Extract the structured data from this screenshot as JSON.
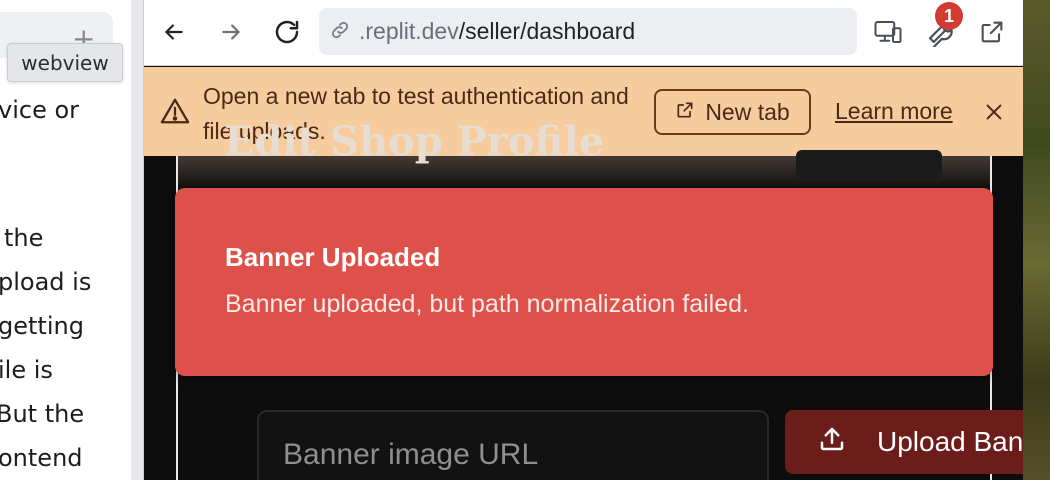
{
  "chat": {
    "tooltip": "webview",
    "lines": [
      "vice or",
      "the",
      "pload is",
      "getting",
      "ile is",
      "But the",
      "ontend"
    ]
  },
  "browser": {
    "url_host": ".replit.dev",
    "url_path": "/seller/dashboard",
    "badge_count": "1",
    "icons": [
      "back-arrow-icon",
      "forward-arrow-icon",
      "reload-icon",
      "link-icon",
      "devices-icon",
      "wrench-icon",
      "open-external-icon"
    ]
  },
  "notice": {
    "message": "Open a new tab to test authentication and file uploads.",
    "new_tab_label": "New tab",
    "learn_more_label": "Learn more"
  },
  "page": {
    "heading": "Edit Shop Profile"
  },
  "toast": {
    "title": "Banner Uploaded",
    "message": "Banner uploaded, but path normalization failed."
  },
  "form": {
    "banner_url_placeholder": "Banner image URL",
    "upload_button_label": "Upload Banner"
  },
  "colors": {
    "notice_bg": "#f6cb9e",
    "toast_bg": "#de514a",
    "upload_btn_bg": "#6d1d19",
    "badge_bg": "#d23b32"
  }
}
